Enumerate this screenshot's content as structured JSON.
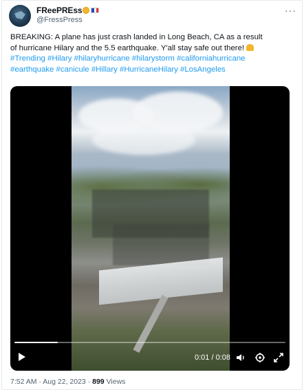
{
  "author": {
    "display_name": "FReePREss",
    "handle": "@FressPress",
    "avatar_icon": "account-avatar",
    "name_emojis": [
      "sun-emoji",
      "france-flag"
    ],
    "flag_colors": [
      "#1f4fb0",
      "#ffffff",
      "#e2323a"
    ]
  },
  "menu_icon": "more-options-icon",
  "tweet": {
    "line1": "BREAKING: A plane has just crash landed in Long Beach, CA as a result",
    "line2": "of hurricane Hilary and the 5.5 earthquake. Y'all stay safe out there!",
    "emoji": "folded-hands-emoji",
    "hashtags": [
      "#Trending",
      "#Hilary",
      "#hilaryhurricane",
      "#hilarystorm",
      "#californiahurricane",
      "#earthquake",
      "#canicule",
      "#Hillary",
      "#HurricaneHilary",
      "#LosAngeles"
    ]
  },
  "video": {
    "elapsed": "0:01",
    "duration": "0:08",
    "time_display": "0:01 / 0:08",
    "progress_fraction": 0.16,
    "controls": [
      "play-icon",
      "volume-icon",
      "settings-icon",
      "fullscreen-icon"
    ]
  },
  "meta": {
    "time": "7:52 AM",
    "date": "Aug 22, 2023",
    "separator": "·",
    "views_count": "899",
    "views_label": "Views"
  },
  "colors": {
    "link": "#1d9bf0",
    "text": "#0f1419",
    "secondary": "#536471"
  }
}
